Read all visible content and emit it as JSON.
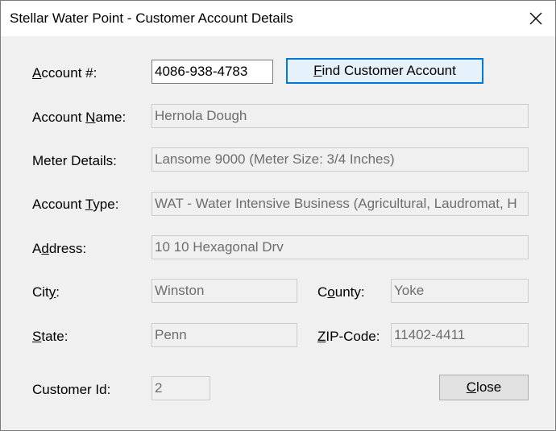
{
  "window": {
    "title": "Stellar Water Point - Customer Account Details"
  },
  "form": {
    "account_number": {
      "label_prefix": "",
      "label_mnemonic": "A",
      "label_rest": "ccount #:",
      "value": "4086-938-4783"
    },
    "account_name": {
      "label_prefix": "Account ",
      "label_mnemonic": "N",
      "label_rest": "ame:",
      "value": "Hernola Dough"
    },
    "meter_details": {
      "label": "Meter Details:",
      "value": "Lansome 9000 (Meter Size: 3/4 Inches)"
    },
    "account_type": {
      "label_prefix": "Account ",
      "label_mnemonic": "T",
      "label_rest": "ype:",
      "value": "WAT - Water Intensive Business (Agricultural, Laudromat, H"
    },
    "address": {
      "label_prefix": "A",
      "label_mnemonic": "d",
      "label_rest": "dress:",
      "value": "10 10 Hexagonal Drv"
    },
    "city": {
      "label_prefix": "Cit",
      "label_mnemonic": "y",
      "label_rest": ":",
      "value": "Winston"
    },
    "county": {
      "label_prefix": "C",
      "label_mnemonic": "o",
      "label_rest": "unty:",
      "value": "Yoke"
    },
    "state": {
      "label_prefix": "",
      "label_mnemonic": "S",
      "label_rest": "tate:",
      "value": "Penn"
    },
    "zip": {
      "label_prefix": "",
      "label_mnemonic": "Z",
      "label_rest": "IP-Code:",
      "value": "11402-4411"
    },
    "customer_id": {
      "label": "Customer Id:",
      "value": "2"
    }
  },
  "buttons": {
    "find_prefix": "",
    "find_mnemonic": "F",
    "find_rest": "ind Customer Account",
    "close_prefix": "",
    "close_mnemonic": "C",
    "close_rest": "lose"
  },
  "icons": {
    "close": "close-icon"
  }
}
